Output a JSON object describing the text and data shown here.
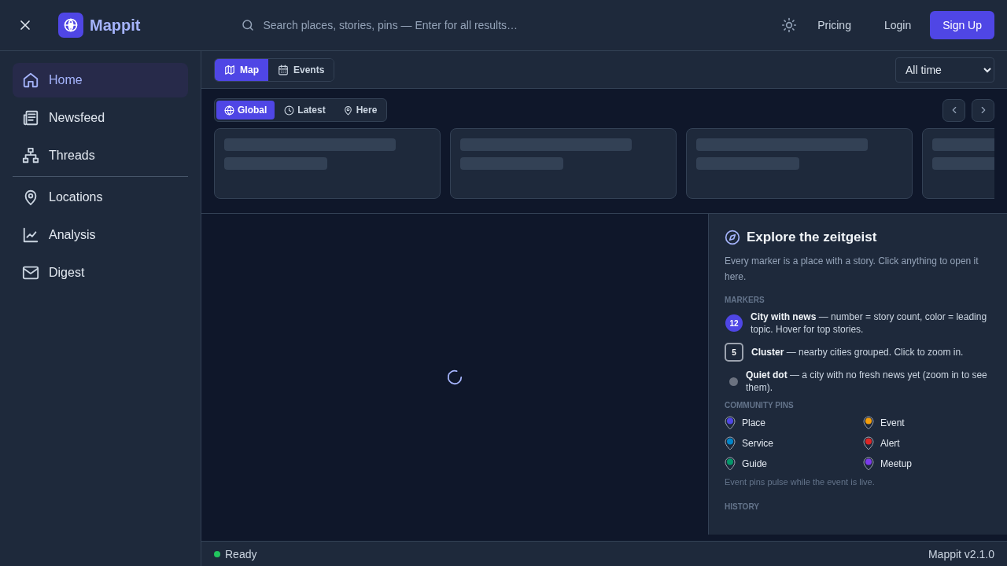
{
  "header": {
    "title": "Mappit",
    "search": {
      "placeholder": "Search places, stories, pins — Enter for all results…"
    },
    "links": [
      "Pricing",
      "Login"
    ],
    "signup": "Sign Up"
  },
  "sidebar": {
    "groups": [
      [
        {
          "label": "Home",
          "kind": "home",
          "selected": true
        },
        {
          "label": "Newsfeed",
          "kind": "newspaper",
          "selected": false
        },
        {
          "label": "Threads",
          "kind": "tree",
          "selected": false
        }
      ],
      [
        {
          "label": "Locations",
          "kind": "pin",
          "selected": false
        },
        {
          "label": "Analysis",
          "kind": "chart",
          "selected": false
        },
        {
          "label": "Digest",
          "kind": "mail",
          "selected": false
        }
      ]
    ]
  },
  "view_tabs": [
    {
      "label": "Map",
      "kind": "map",
      "selected": true
    },
    {
      "label": "Events",
      "kind": "calendar",
      "selected": false
    }
  ],
  "time_filter": {
    "value": "All time"
  },
  "scope_tabs": [
    {
      "label": "Global",
      "kind": "globe",
      "selected": true
    },
    {
      "label": "Latest",
      "kind": "clock",
      "selected": false
    },
    {
      "label": "Here",
      "kind": "pin",
      "selected": false
    }
  ],
  "cards": [
    {
      "kind": "skeleton"
    },
    {
      "kind": "skeleton"
    },
    {
      "kind": "skeleton"
    },
    {
      "kind": "skeleton"
    }
  ],
  "map": {
    "loading": true
  },
  "legend": {
    "title": "Explore the zeitgeist",
    "intro": "Every marker is a place with a story. Click anything to open it here.",
    "markers_heading": "MARKERS",
    "markers": [
      {
        "kind": "badge",
        "label": "12",
        "text": "**City with news** — number = story count, color = leading topic. Hover for top stories."
      },
      {
        "kind": "cluster",
        "label": "5",
        "text": "**Cluster** — nearby cities grouped. Click to zoom in."
      },
      {
        "kind": "dot",
        "text": "**Quiet dot** — a city with no fresh news yet (zoom in to see them)."
      }
    ],
    "pins_heading": "COMMUNITY PINS",
    "pins": [
      {
        "label": "Place",
        "color": "#4f46e5"
      },
      {
        "label": "Event",
        "color": "#f59e0b"
      },
      {
        "label": "Service",
        "color": "#0284c7"
      },
      {
        "label": "Alert",
        "color": "#dc2626"
      },
      {
        "label": "Guide",
        "color": "#059669"
      },
      {
        "label": "Meetup",
        "color": "#7c3aed"
      }
    ],
    "pins_note": "Event pins pulse while the event is live.",
    "history_heading": "HISTORY"
  },
  "status_bar": {
    "status": "Ready",
    "version": "Mappit v2.1.0"
  }
}
